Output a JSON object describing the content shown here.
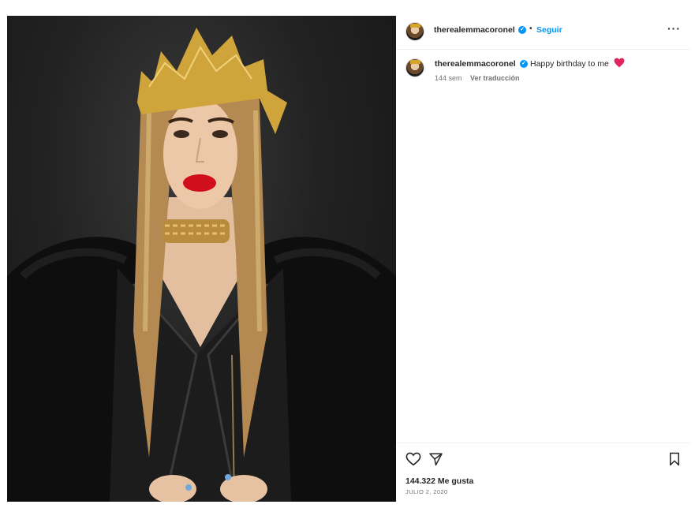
{
  "post": {
    "username": "therealemmacoronel",
    "verified_mark": "✓",
    "separator": "•",
    "follow_label": "Seguir",
    "more_label": "···",
    "image_alt": "Woman with long blonde hair, gold crown, red lips, gold chain choker, black leather jacket and black fur coat"
  },
  "comment": {
    "username": "therealemmacoronel",
    "text": "Happy birthday to me",
    "emoji": "red-heart",
    "time": "144 sem",
    "translate_label": "Ver traducción"
  },
  "actions": {
    "like_icon": "heart-outline-icon",
    "share_icon": "paper-plane-icon",
    "save_icon": "bookmark-icon",
    "likes": "144.322 Me gusta",
    "date": "JULIO 2, 2020"
  },
  "colors": {
    "link": "#0095f6",
    "muted": "#737373",
    "text": "#262626",
    "heart": "#e0245e"
  }
}
